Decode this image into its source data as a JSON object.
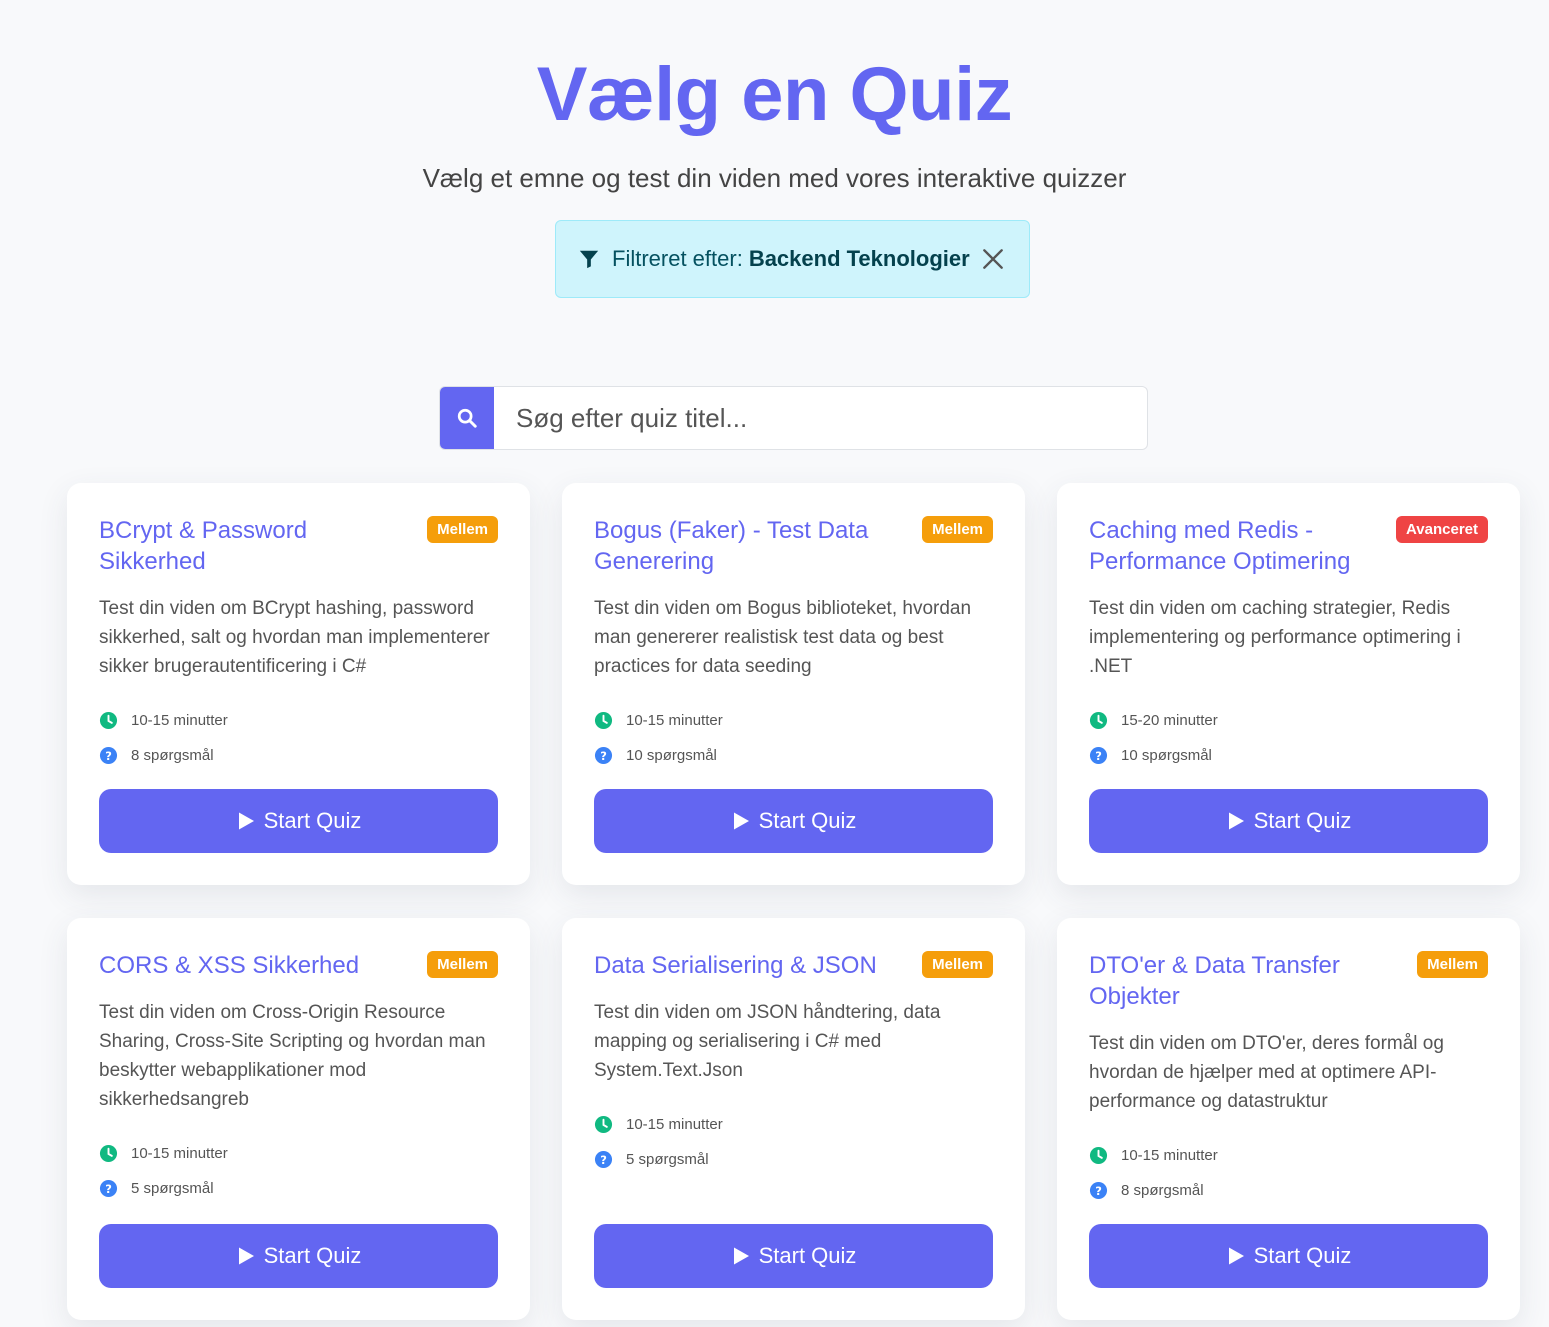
{
  "header": {
    "title": "Vælg en Quiz",
    "subtitle": "Vælg et emne og test din viden med vores interaktive quizzer"
  },
  "filter": {
    "label": "Filtreret efter:",
    "value": "Backend Teknologier"
  },
  "search": {
    "placeholder": "Søg efter quiz titel..."
  },
  "colors": {
    "accent": "#6366f1",
    "badge_mellem": "#f59e0b",
    "badge_avanceret": "#ef4444",
    "clock_icon": "#10b981",
    "question_icon": "#3b82f6"
  },
  "quizzes": [
    {
      "title": "BCrypt & Password Sikkerhed",
      "level": "Mellem",
      "description": "Test din viden om BCrypt hashing, password sikkerhed, salt og hvordan man implementerer sikker brugerautentificering i C#",
      "duration": "10-15 minutter",
      "questions": "8 spørgsmål",
      "button": "Start Quiz"
    },
    {
      "title": "Bogus (Faker) - Test Data Generering",
      "level": "Mellem",
      "description": "Test din viden om Bogus biblioteket, hvordan man genererer realistisk test data og best practices for data seeding",
      "duration": "10-15 minutter",
      "questions": "10 spørgsmål",
      "button": "Start Quiz"
    },
    {
      "title": "Caching med Redis - Performance Optimering",
      "level": "Avanceret",
      "description": "Test din viden om caching strategier, Redis implementering og performance optimering i .NET",
      "duration": "15-20 minutter",
      "questions": "10 spørgsmål",
      "button": "Start Quiz"
    },
    {
      "title": "CORS & XSS Sikkerhed",
      "level": "Mellem",
      "description": "Test din viden om Cross-Origin Resource Sharing, Cross-Site Scripting og hvordan man beskytter webapplikationer mod sikkerhedsangreb",
      "duration": "10-15 minutter",
      "questions": "5 spørgsmål",
      "button": "Start Quiz"
    },
    {
      "title": "Data Serialisering & JSON",
      "level": "Mellem",
      "description": "Test din viden om JSON håndtering, data mapping og serialisering i C# med System.Text.Json",
      "duration": "10-15 minutter",
      "questions": "5 spørgsmål",
      "button": "Start Quiz"
    },
    {
      "title": "DTO'er & Data Transfer Objekter",
      "level": "Mellem",
      "description": "Test din viden om DTO'er, deres formål og hvordan de hjælper med at optimere API-performance og datastruktur",
      "duration": "10-15 minutter",
      "questions": "8 spørgsmål",
      "button": "Start Quiz"
    }
  ]
}
